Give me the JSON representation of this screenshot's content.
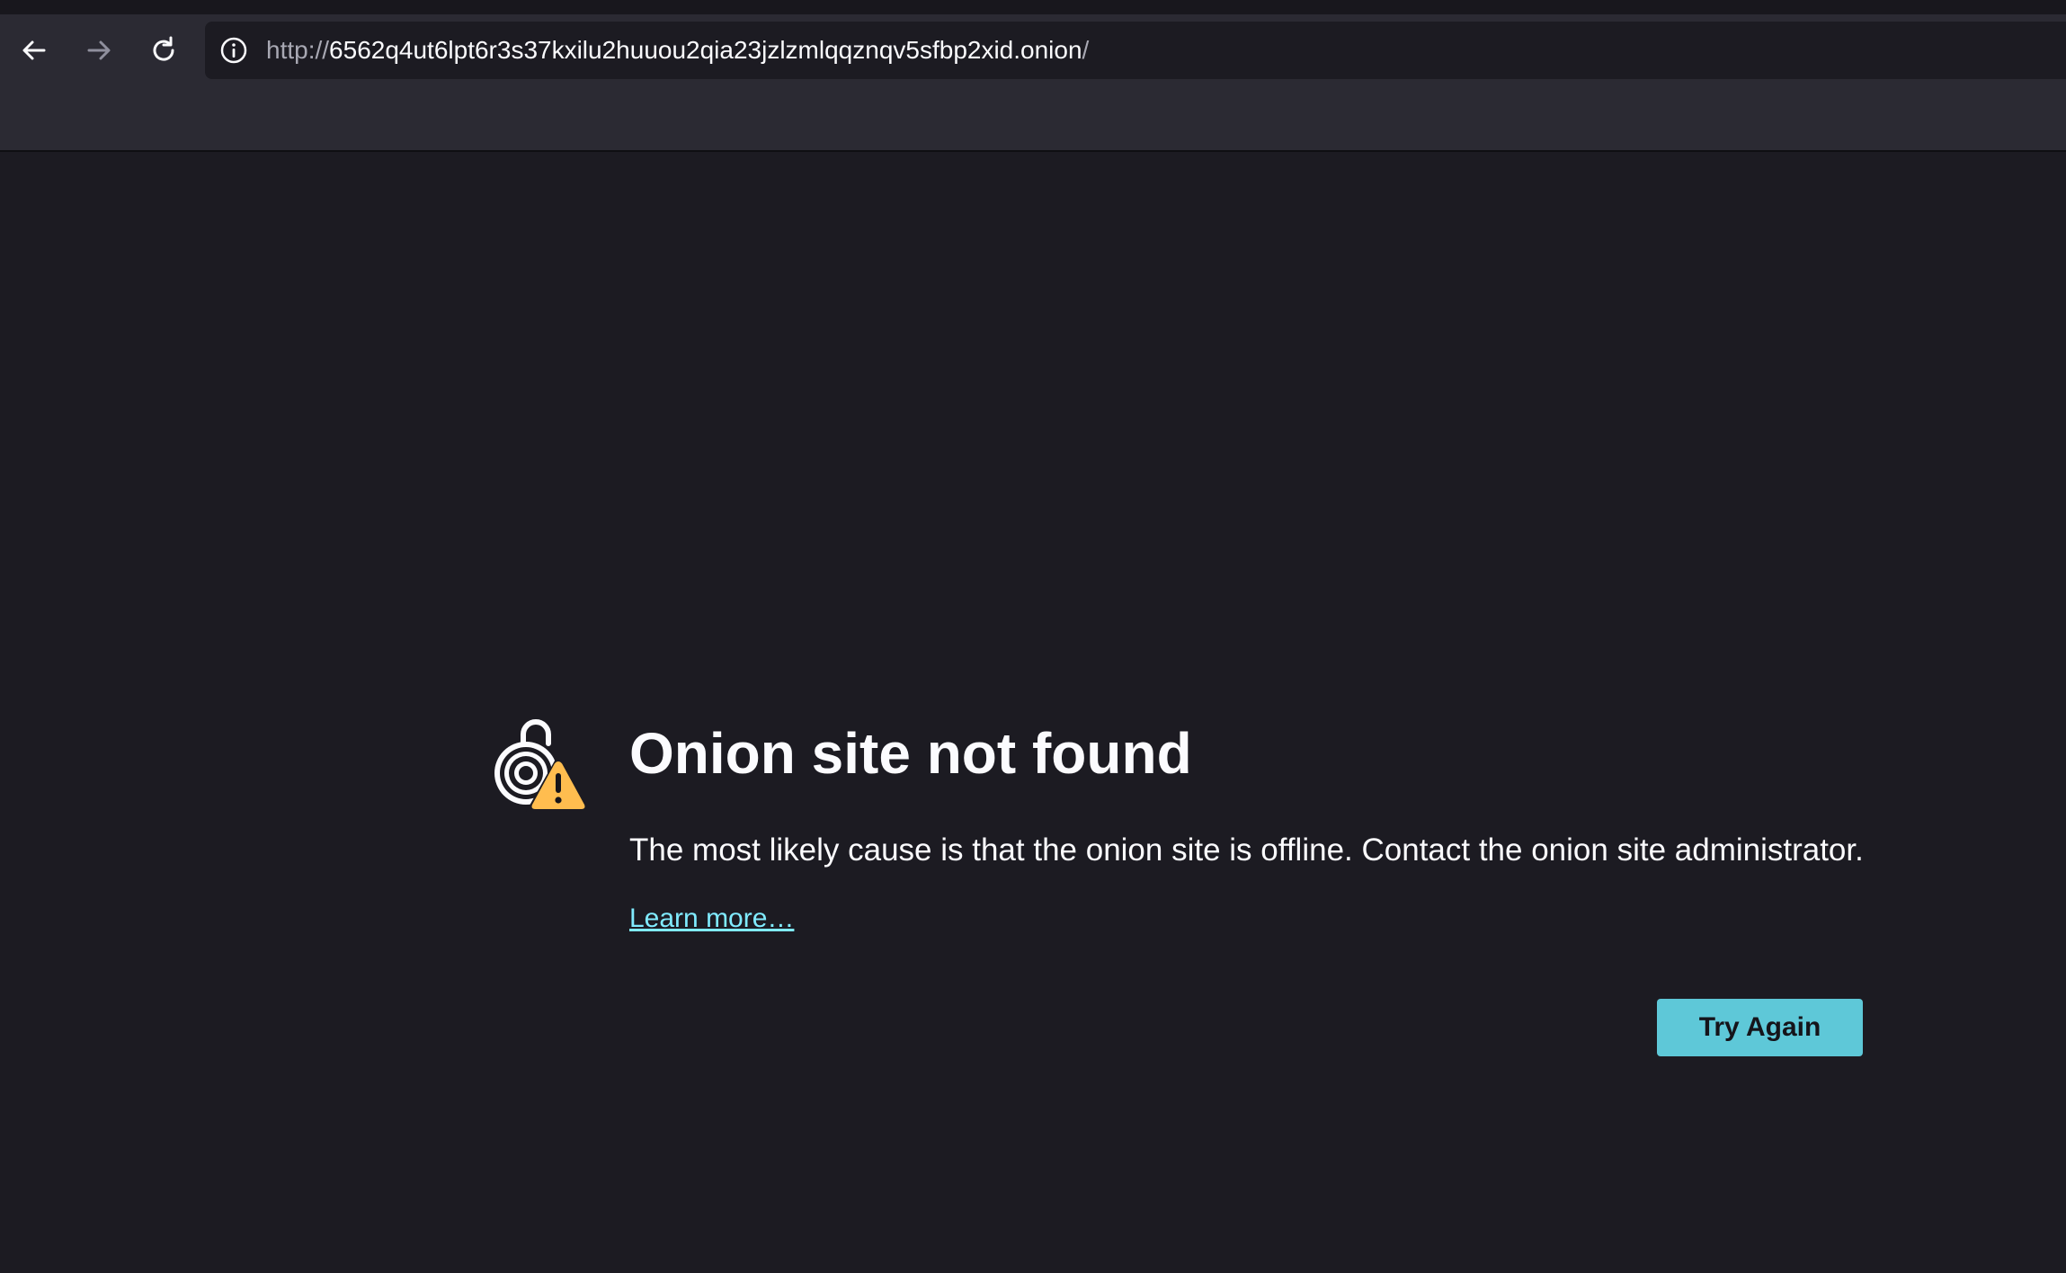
{
  "browser": {
    "url_scheme": "http://",
    "url_host": "6562q4ut6lpt6r3s37kxilu2huuou2qia23jzlzmlqqznqv5sfbp2xid.onion",
    "url_path": "/"
  },
  "error": {
    "title": "Onion site not found",
    "description": "The most likely cause is that the onion site is offline. Contact the onion site administrator.",
    "learn_more": "Learn more…",
    "try_again": "Try Again"
  },
  "colors": {
    "accent": "#5ec8d8",
    "link": "#80ebff",
    "warning": "#ffbd4f",
    "background": "#1c1b22",
    "toolbar": "#2b2a33"
  }
}
